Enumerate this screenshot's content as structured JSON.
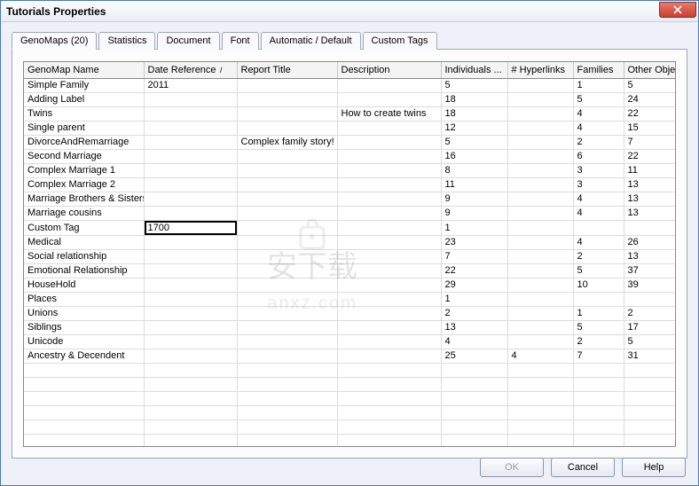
{
  "window": {
    "title": "Tutorials Properties"
  },
  "tabs": [
    {
      "label": "GenoMaps (20)",
      "active": true
    },
    {
      "label": "Statistics"
    },
    {
      "label": "Document"
    },
    {
      "label": "Font"
    },
    {
      "label": "Automatic / Default"
    },
    {
      "label": "Custom Tags"
    }
  ],
  "columns": [
    "GenoMap Name",
    "Date Reference",
    "Report Title",
    "Description",
    "Individuals ...",
    "# Hyperlinks",
    "Families",
    "Other Objects"
  ],
  "sort_col": 1,
  "rows": [
    {
      "c": [
        "Simple Family",
        "2011",
        "",
        "",
        "5",
        "",
        "1",
        "5"
      ]
    },
    {
      "c": [
        "Adding Label",
        "",
        "",
        "",
        "18",
        "",
        "5",
        "24"
      ]
    },
    {
      "c": [
        "Twins",
        "",
        "",
        "How to create twins",
        "18",
        "",
        "4",
        "22"
      ]
    },
    {
      "c": [
        "Single parent",
        "",
        "",
        "",
        "12",
        "",
        "4",
        "15"
      ]
    },
    {
      "c": [
        "DivorceAndRemarriage",
        "",
        "Complex family story!",
        "",
        "5",
        "",
        "2",
        "7"
      ]
    },
    {
      "c": [
        "Second Marriage",
        "",
        "",
        "",
        "16",
        "",
        "6",
        "22"
      ]
    },
    {
      "c": [
        "Complex Marriage 1",
        "",
        "",
        "",
        "8",
        "",
        "3",
        "11"
      ]
    },
    {
      "c": [
        "Complex Marriage 2",
        "",
        "",
        "",
        "11",
        "",
        "3",
        "13"
      ]
    },
    {
      "c": [
        "Marriage Brothers & Sisters",
        "",
        "",
        "",
        "9",
        "",
        "4",
        "13"
      ]
    },
    {
      "c": [
        "Marriage cousins",
        "",
        "",
        "",
        "9",
        "",
        "4",
        "13"
      ]
    },
    {
      "c": [
        "Custom Tag",
        "1700",
        "",
        "",
        "1",
        "",
        "",
        ""
      ],
      "editing": 1
    },
    {
      "c": [
        "Medical",
        "",
        "",
        "",
        "23",
        "",
        "4",
        "26"
      ]
    },
    {
      "c": [
        "Social relationship",
        "",
        "",
        "",
        "7",
        "",
        "2",
        "13"
      ]
    },
    {
      "c": [
        "Emotional Relationship",
        "",
        "",
        "",
        "22",
        "",
        "5",
        "37"
      ]
    },
    {
      "c": [
        "HouseHold",
        "",
        "",
        "",
        "29",
        "",
        "10",
        "39"
      ]
    },
    {
      "c": [
        "Places",
        "",
        "",
        "",
        "1",
        "",
        "",
        ""
      ]
    },
    {
      "c": [
        "Unions",
        "",
        "",
        "",
        "2",
        "",
        "1",
        "2"
      ]
    },
    {
      "c": [
        "Siblings",
        "",
        "",
        "",
        "13",
        "",
        "5",
        "17"
      ]
    },
    {
      "c": [
        "Unicode",
        "",
        "",
        "",
        "4",
        "",
        "2",
        "5"
      ]
    },
    {
      "c": [
        "Ancestry & Decendent",
        "",
        "",
        "",
        "25",
        "4",
        "7",
        "31"
      ]
    },
    {
      "c": [
        "",
        "",
        "",
        "",
        "",
        "",
        "",
        ""
      ]
    },
    {
      "c": [
        "",
        "",
        "",
        "",
        "",
        "",
        "",
        ""
      ]
    },
    {
      "c": [
        "",
        "",
        "",
        "",
        "",
        "",
        "",
        ""
      ]
    },
    {
      "c": [
        "",
        "",
        "",
        "",
        "",
        "",
        "",
        ""
      ]
    },
    {
      "c": [
        "",
        "",
        "",
        "",
        "",
        "",
        "",
        ""
      ]
    },
    {
      "c": [
        "",
        "",
        "",
        "",
        "",
        "",
        "",
        ""
      ]
    }
  ],
  "buttons": {
    "ok": "OK",
    "cancel": "Cancel",
    "help": "Help"
  },
  "watermark": {
    "text": "安下载",
    "url": "anxz.com"
  }
}
